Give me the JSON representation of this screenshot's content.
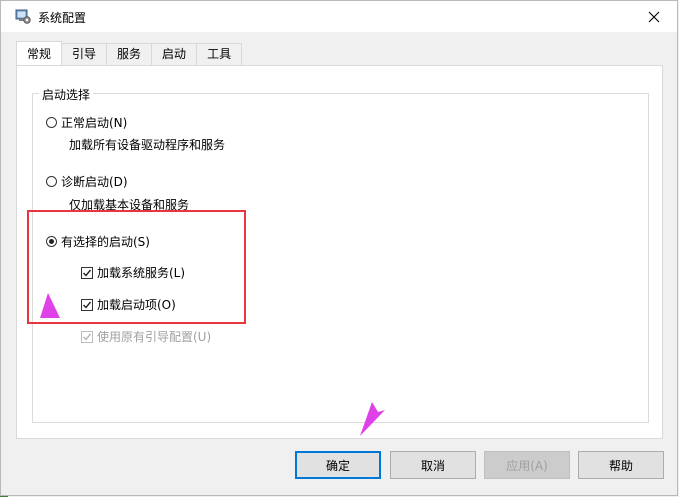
{
  "window": {
    "title": "系统配置"
  },
  "tabs": [
    {
      "label": "常规",
      "active": true
    },
    {
      "label": "引导",
      "active": false
    },
    {
      "label": "服务",
      "active": false
    },
    {
      "label": "启动",
      "active": false
    },
    {
      "label": "工具",
      "active": false
    }
  ],
  "startup_selection": {
    "legend": "启动选择",
    "normal": {
      "label": "正常启动(N)",
      "desc": "加载所有设备驱动程序和服务",
      "checked": false
    },
    "diagnostic": {
      "label": "诊断启动(D)",
      "desc": "仅加载基本设备和服务",
      "checked": false
    },
    "selective": {
      "label": "有选择的启动(S)",
      "checked": true
    },
    "options": [
      {
        "label": "加载系统服务(L)",
        "checked": true,
        "enabled": true
      },
      {
        "label": "加载启动项(O)",
        "checked": true,
        "enabled": true
      },
      {
        "label": "使用原有引导配置(U)",
        "checked": true,
        "enabled": false
      }
    ]
  },
  "buttons": {
    "ok": "确定",
    "cancel": "取消",
    "apply": "应用(A)",
    "help": "帮助"
  },
  "annotation_colors": {
    "box": "#e8363e",
    "arrow": "#e040e8"
  }
}
